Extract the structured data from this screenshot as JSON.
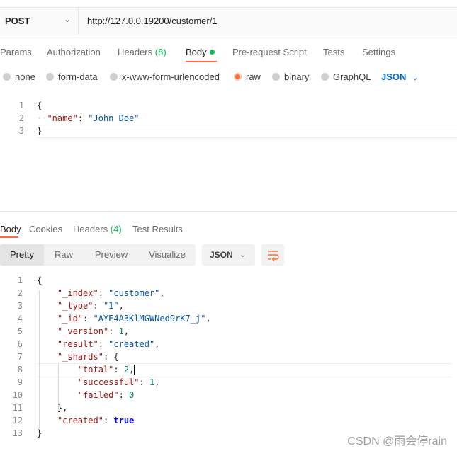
{
  "request": {
    "method": "POST",
    "url": "http://127.0.0.19200/customer/1",
    "tabs": {
      "params": "Params",
      "authorization": "Authorization",
      "headers": "Headers",
      "headers_count": "(8)",
      "body": "Body",
      "prerequest": "Pre-request Script",
      "tests": "Tests",
      "settings": "Settings"
    },
    "body_types": [
      "none",
      "form-data",
      "x-www-form-urlencoded",
      "raw",
      "binary",
      "GraphQL"
    ],
    "selected_body_type": "raw",
    "language": "JSON",
    "editor": {
      "line_numbers": [
        "1",
        "2",
        "3"
      ],
      "open_brace": "{",
      "key": "\"name\"",
      "value": "\"John Doe\"",
      "close_brace": "}"
    }
  },
  "response": {
    "tabs": {
      "body": "Body",
      "cookies": "Cookies",
      "headers": "Headers",
      "headers_count": "(4)",
      "test_results": "Test Results"
    },
    "view_modes": [
      "Pretty",
      "Raw",
      "Preview",
      "Visualize"
    ],
    "active_view": "Pretty",
    "format": "JSON",
    "line_numbers": [
      "1",
      "2",
      "3",
      "4",
      "5",
      "6",
      "7",
      "8",
      "9",
      "10",
      "11",
      "12",
      "13"
    ],
    "json": {
      "open": "{",
      "index_key": "\"_index\"",
      "index_val": "\"customer\"",
      "type_key": "\"_type\"",
      "type_val": "\"1\"",
      "id_key": "\"_id\"",
      "id_val": "\"AYE4A3KlMGWNed9rK7_j\"",
      "version_key": "\"_version\"",
      "version_val": "1",
      "result_key": "\"result\"",
      "result_val": "\"created\"",
      "shards_key": "\"_shards\"",
      "shards_open": "{",
      "total_key": "\"total\"",
      "total_val": "2",
      "successful_key": "\"successful\"",
      "successful_val": "1",
      "failed_key": "\"failed\"",
      "failed_val": "0",
      "shards_close": "}",
      "created_key": "\"created\"",
      "created_val": "true",
      "close": "}"
    }
  },
  "watermark": "CSDN @雨会停rain",
  "colors": {
    "accent": "#ff6c37",
    "count_green": "#0cbb52",
    "link_blue": "#0265d2"
  }
}
